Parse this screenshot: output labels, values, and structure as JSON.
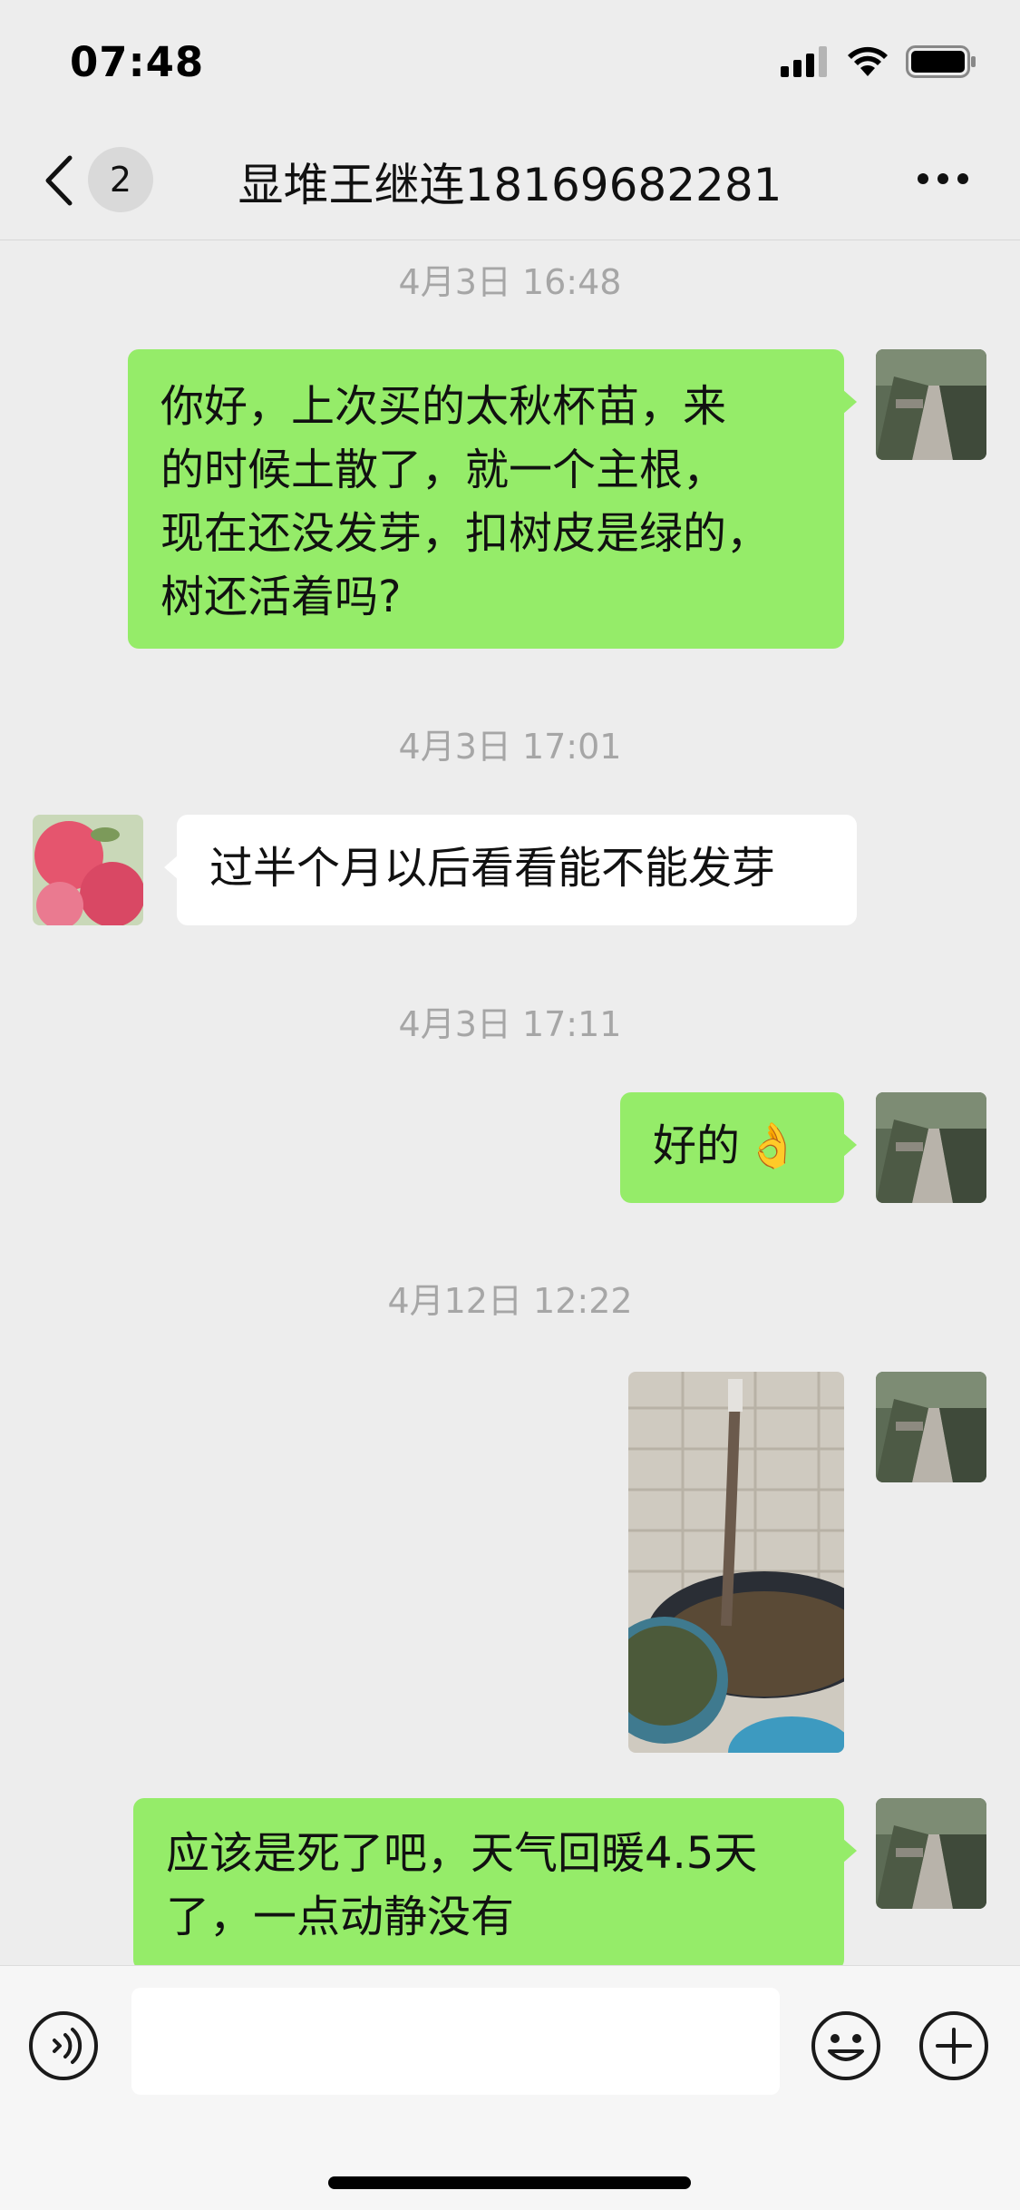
{
  "status_bar": {
    "time": "07:48"
  },
  "header": {
    "unread_count": "2",
    "title": "显堆王继连18169682281"
  },
  "messages": [
    {
      "type": "timestamp",
      "text": "4月3日 16:48"
    },
    {
      "type": "text",
      "sender": "me",
      "text": "你好，上次买的太秋杯苗，来\n的时候土散了，就一个主根，\n现在还没发芽，扣树皮是绿的，\n树还活着吗?"
    },
    {
      "type": "timestamp",
      "text": "4月3日 17:01"
    },
    {
      "type": "text",
      "sender": "other",
      "text": "过半个月以后看看能不能发芽"
    },
    {
      "type": "timestamp",
      "text": "4月3日 17:11"
    },
    {
      "type": "text",
      "sender": "me",
      "text": "好的",
      "emoji": "👌"
    },
    {
      "type": "timestamp",
      "text": "4月12日 12:22"
    },
    {
      "type": "image",
      "sender": "me",
      "icon": "photo-of-tree-seedling-in-pot"
    },
    {
      "type": "text",
      "sender": "me",
      "text": "应该是死了吧，天气回暖4.5天\n了，一点动静没有"
    }
  ],
  "input": {
    "placeholder": "",
    "value": ""
  },
  "colors": {
    "outgoing_bubble": "#95ec69",
    "incoming_bubble": "#ffffff",
    "background": "#ededed",
    "timestamp_text": "#a6a6a6"
  },
  "icons": {
    "back": "chevron-left-icon",
    "more": "more-dots-icon",
    "voice": "voice-icon",
    "emoji": "smiley-icon",
    "plus": "plus-icon"
  }
}
